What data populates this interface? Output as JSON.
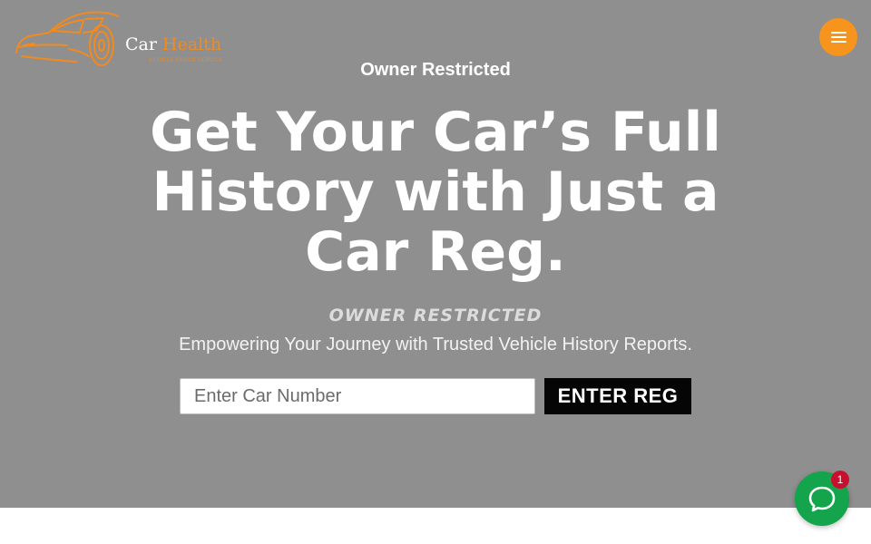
{
  "logo": {
    "brand_word1": "Car",
    "brand_word2": "Health",
    "tagline": "VEHICLE CHECK SERVICE"
  },
  "header": {
    "menu_icon": "hamburger-icon"
  },
  "hero": {
    "eyebrow": "Owner Restricted",
    "headline": "Get Your Car’s Full History with Just a Car Reg.",
    "subtitle": "OWNER RESTRICTED",
    "tagline": "Empowering Your Journey with Trusted Vehicle History Reports."
  },
  "search": {
    "placeholder": "Enter Car Number",
    "value": "",
    "button_label": "ENTER REG"
  },
  "chat": {
    "icon": "chat-bubble-icon",
    "badge_count": "1"
  },
  "colors": {
    "hero_background": "#8f8f8f",
    "accent": "#f7941d",
    "button": "#050505",
    "chat": "#13a44c",
    "badge": "#c8102e"
  }
}
